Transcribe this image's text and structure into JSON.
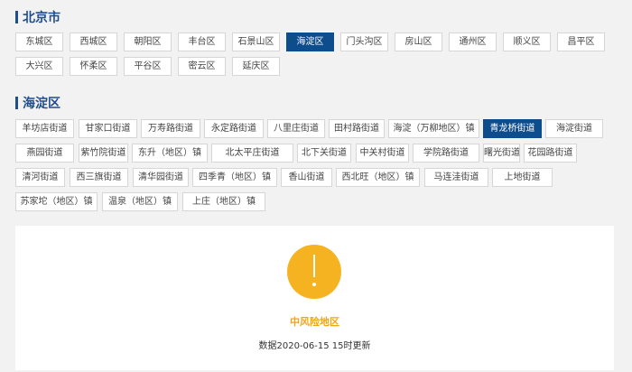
{
  "city_section": {
    "title": "北京市",
    "districts": [
      {
        "label": "东城区",
        "active": false
      },
      {
        "label": "西城区",
        "active": false
      },
      {
        "label": "朝阳区",
        "active": false
      },
      {
        "label": "丰台区",
        "active": false
      },
      {
        "label": "石景山区",
        "active": false
      },
      {
        "label": "海淀区",
        "active": true
      },
      {
        "label": "门头沟区",
        "active": false
      },
      {
        "label": "房山区",
        "active": false
      },
      {
        "label": "通州区",
        "active": false
      },
      {
        "label": "顺义区",
        "active": false
      },
      {
        "label": "昌平区",
        "active": false
      },
      {
        "label": "大兴区",
        "active": false
      },
      {
        "label": "怀柔区",
        "active": false
      },
      {
        "label": "平谷区",
        "active": false
      },
      {
        "label": "密云区",
        "active": false
      },
      {
        "label": "延庆区",
        "active": false
      }
    ]
  },
  "district_section": {
    "title": "海淀区",
    "streets": [
      {
        "label": "羊坊店街道",
        "active": false
      },
      {
        "label": "甘家口街道",
        "active": false
      },
      {
        "label": "万寿路街道",
        "active": false
      },
      {
        "label": "永定路街道",
        "active": false
      },
      {
        "label": "八里庄街道",
        "active": false
      },
      {
        "label": "田村路街道",
        "active": false
      },
      {
        "label": "海淀（万柳地区）镇",
        "active": false
      },
      {
        "label": "青龙桥街道",
        "active": true
      },
      {
        "label": "海淀街道",
        "active": false
      },
      {
        "label": "燕园街道",
        "active": false
      },
      {
        "label": "紫竹院街道",
        "active": false
      },
      {
        "label": "东升（地区）镇",
        "active": false
      },
      {
        "label": "北太平庄街道",
        "active": false
      },
      {
        "label": "北下关街道",
        "active": false
      },
      {
        "label": "中关村街道",
        "active": false
      },
      {
        "label": "学院路街道",
        "active": false
      },
      {
        "label": "曙光街道",
        "active": false
      },
      {
        "label": "花园路街道",
        "active": false
      },
      {
        "label": "清河街道",
        "active": false
      },
      {
        "label": "西三旗街道",
        "active": false
      },
      {
        "label": "清华园街道",
        "active": false
      },
      {
        "label": "四季青（地区）镇",
        "active": false
      },
      {
        "label": "香山街道",
        "active": false
      },
      {
        "label": "西北旺（地区）镇",
        "active": false
      },
      {
        "label": "马连洼街道",
        "active": false
      },
      {
        "label": "上地街道",
        "active": false
      },
      {
        "label": "苏家坨（地区）镇",
        "active": false
      },
      {
        "label": "温泉（地区）镇",
        "active": false
      },
      {
        "label": "上庄（地区）镇",
        "active": false
      }
    ]
  },
  "result_panel": {
    "icon": "exclamation-icon",
    "risk_level": "中风险地区",
    "update_note": "数据2020-06-15 15时更新"
  },
  "colors": {
    "accent": "#0d4d8d",
    "title": "#1f4e8c",
    "warning": "#f5b321",
    "risk_text": "#f0a70f"
  }
}
